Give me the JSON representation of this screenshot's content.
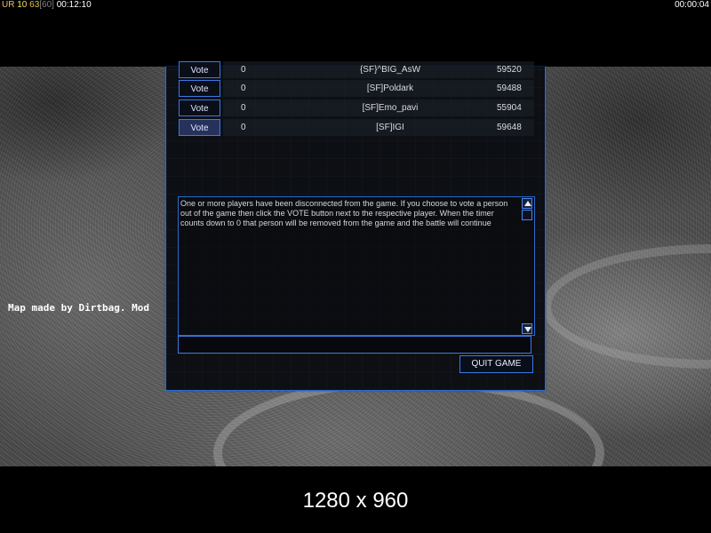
{
  "hud": {
    "mode": "UR",
    "count1": "10",
    "count2": "63",
    "fps": "[60]",
    "game_time": "00:12:10",
    "vote_timer": "00:00:04"
  },
  "map": {
    "credit": "Map made by Dirtbag. Mod"
  },
  "dialog": {
    "players": [
      {
        "vote_label": "Vote",
        "votes": "0",
        "name": "{SF}^BIG_AsW",
        "score": "59520"
      },
      {
        "vote_label": "Vote",
        "votes": "0",
        "name": "[SF]Poldark",
        "score": "59488"
      },
      {
        "vote_label": "Vote",
        "votes": "0",
        "name": "[SF]Emo_pavi",
        "score": "55904"
      },
      {
        "vote_label": "Vote",
        "votes": "0",
        "name": "[SF]IGI",
        "score": "59648"
      }
    ],
    "message": "One or more players have been disconnected from the game. If you choose to vote a person out of the game then click the VOTE button next to the respective player. When the timer counts down to 0 that person will be removed from the game and the battle will continue",
    "chat_value": "",
    "quit_label": "QUIT GAME"
  },
  "footer": {
    "resolution": "1280 x 960"
  }
}
